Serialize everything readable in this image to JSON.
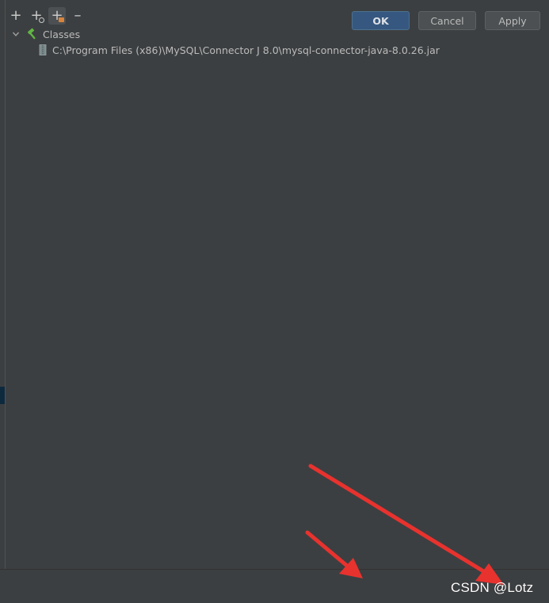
{
  "toolbar": {
    "buttons": [
      {
        "name": "add",
        "icon": "plus-icon"
      },
      {
        "name": "add-root",
        "icon": "plus-attach-icon"
      },
      {
        "name": "add-library",
        "icon": "plus-library-icon"
      },
      {
        "name": "remove",
        "icon": "minus-icon"
      }
    ]
  },
  "tree": {
    "root_label": "Classes",
    "items": [
      {
        "label": "C:\\Program Files (x86)\\MySQL\\Connector J 8.0\\mysql-connector-java-8.0.26.jar",
        "icon": "jar-icon"
      }
    ]
  },
  "footer": {
    "ok_label": "OK",
    "cancel_label": "Cancel",
    "apply_label": "Apply"
  },
  "watermark": "CSDN @Lotz",
  "colors": {
    "background": "#3c3f41",
    "text": "#bbbbbb",
    "ok_button": "#365880",
    "annotation_arrow": "#e8322e",
    "hammer_icon": "#62b543"
  }
}
